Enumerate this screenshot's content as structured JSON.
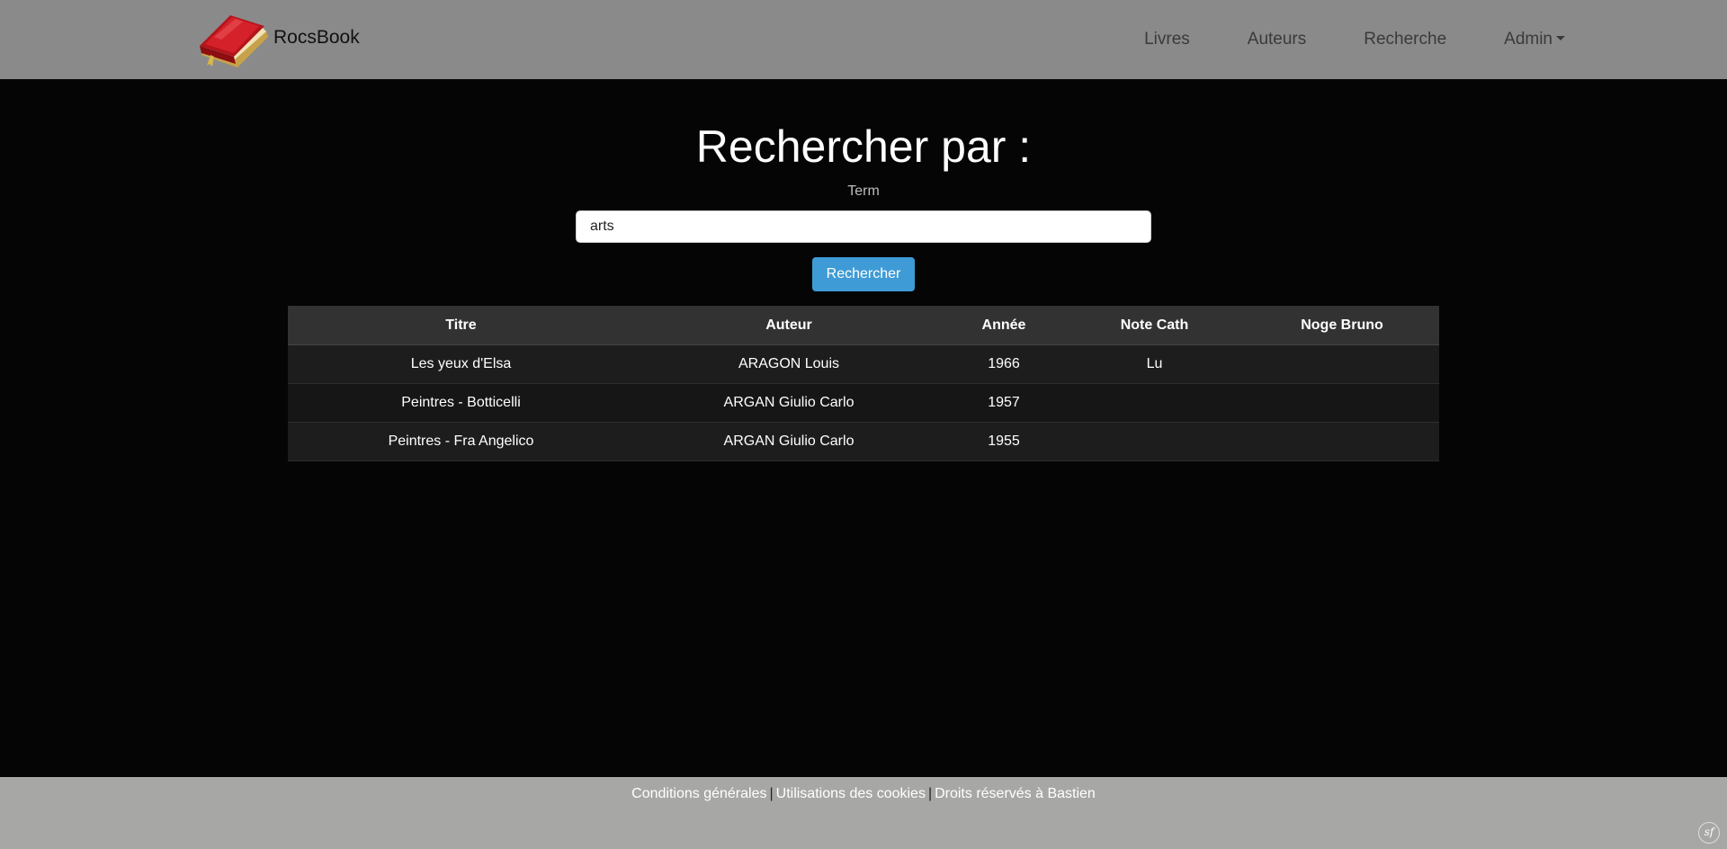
{
  "navbar": {
    "brand": "RocsBook",
    "links": [
      "Livres",
      "Auteurs",
      "Recherche"
    ],
    "admin": "Admin",
    "logo_icon": "book-icon"
  },
  "search": {
    "title": "Rechercher par :",
    "term_label": "Term",
    "value": "arts",
    "button": "Rechercher"
  },
  "results": {
    "headers": [
      "Titre",
      "Auteur",
      "Année",
      "Note Cath",
      "Noge Bruno"
    ],
    "rows": [
      [
        "Les yeux d'Elsa",
        "ARAGON Louis",
        "1966",
        "Lu",
        ""
      ],
      [
        "Peintres - Botticelli",
        "ARGAN Giulio Carlo",
        "1957",
        "",
        ""
      ],
      [
        "Peintres - Fra Angelico",
        "ARGAN Giulio Carlo",
        "1955",
        "",
        ""
      ]
    ]
  },
  "footer": {
    "links": [
      "Conditions générales",
      "Utilisations des cookies",
      "Droits réservés à Bastien"
    ],
    "separator": "|",
    "toolbar_icon": "sf"
  },
  "colors": {
    "navbar_bg": "#8a8a8a",
    "page_bg": "#050505",
    "button_bg": "#3f9bd6",
    "footer_bg": "#a7a8a6"
  }
}
